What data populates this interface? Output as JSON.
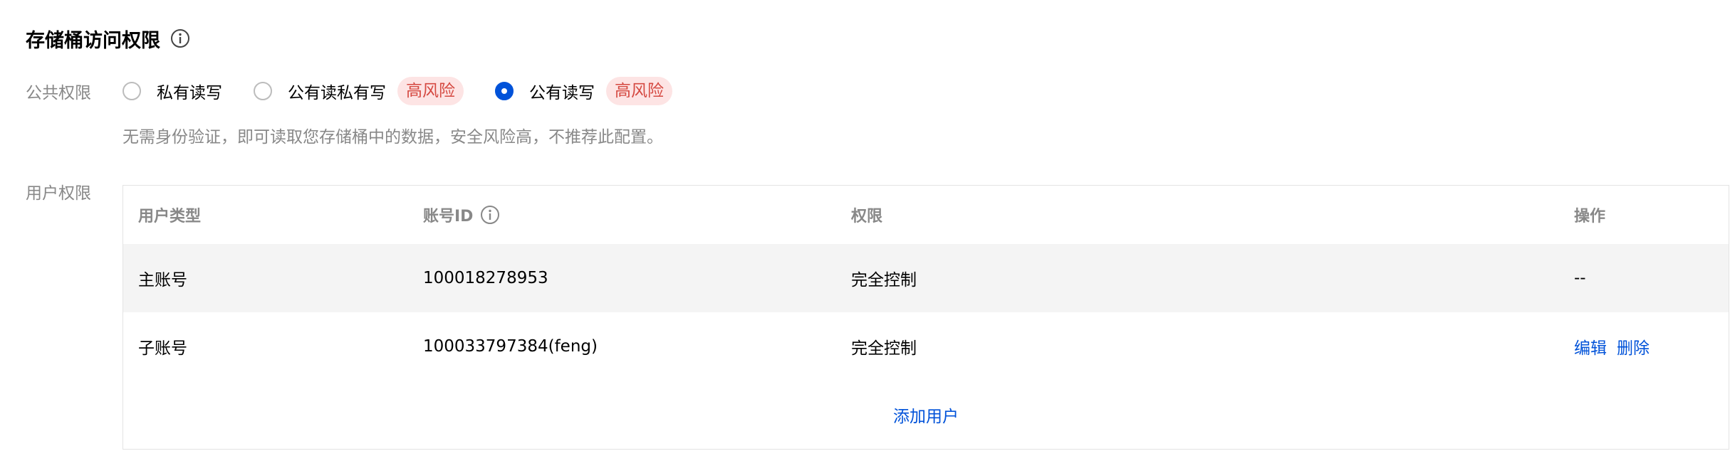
{
  "section": {
    "title": "存储桶访问权限",
    "info_icon": "info-icon"
  },
  "public_permission": {
    "label": "公共权限",
    "options": [
      {
        "label": "私有读写",
        "selected": false,
        "risk": ""
      },
      {
        "label": "公有读私有写",
        "selected": false,
        "risk": "高风险"
      },
      {
        "label": "公有读写",
        "selected": true,
        "risk": "高风险"
      }
    ],
    "hint": "无需身份验证，即可读取您存储桶中的数据，安全风险高，不推荐此配置。"
  },
  "user_permission": {
    "label": "用户权限",
    "columns": [
      "用户类型",
      "账号ID",
      "权限",
      "操作"
    ],
    "rows": [
      {
        "type": "主账号",
        "account_id": "100018278953",
        "permission": "完全控制",
        "actions_text": "--"
      },
      {
        "type": "子账号",
        "account_id": "100033797384(feng)",
        "permission": "完全控制",
        "actions": [
          "编辑",
          "删除"
        ]
      }
    ],
    "add_user": "添加用户"
  },
  "colors": {
    "primary": "#0052d9",
    "risk_text": "#d54941",
    "risk_bg": "#fde4e4",
    "label_gray": "#888888",
    "row_alt_bg": "#f4f4f4"
  }
}
